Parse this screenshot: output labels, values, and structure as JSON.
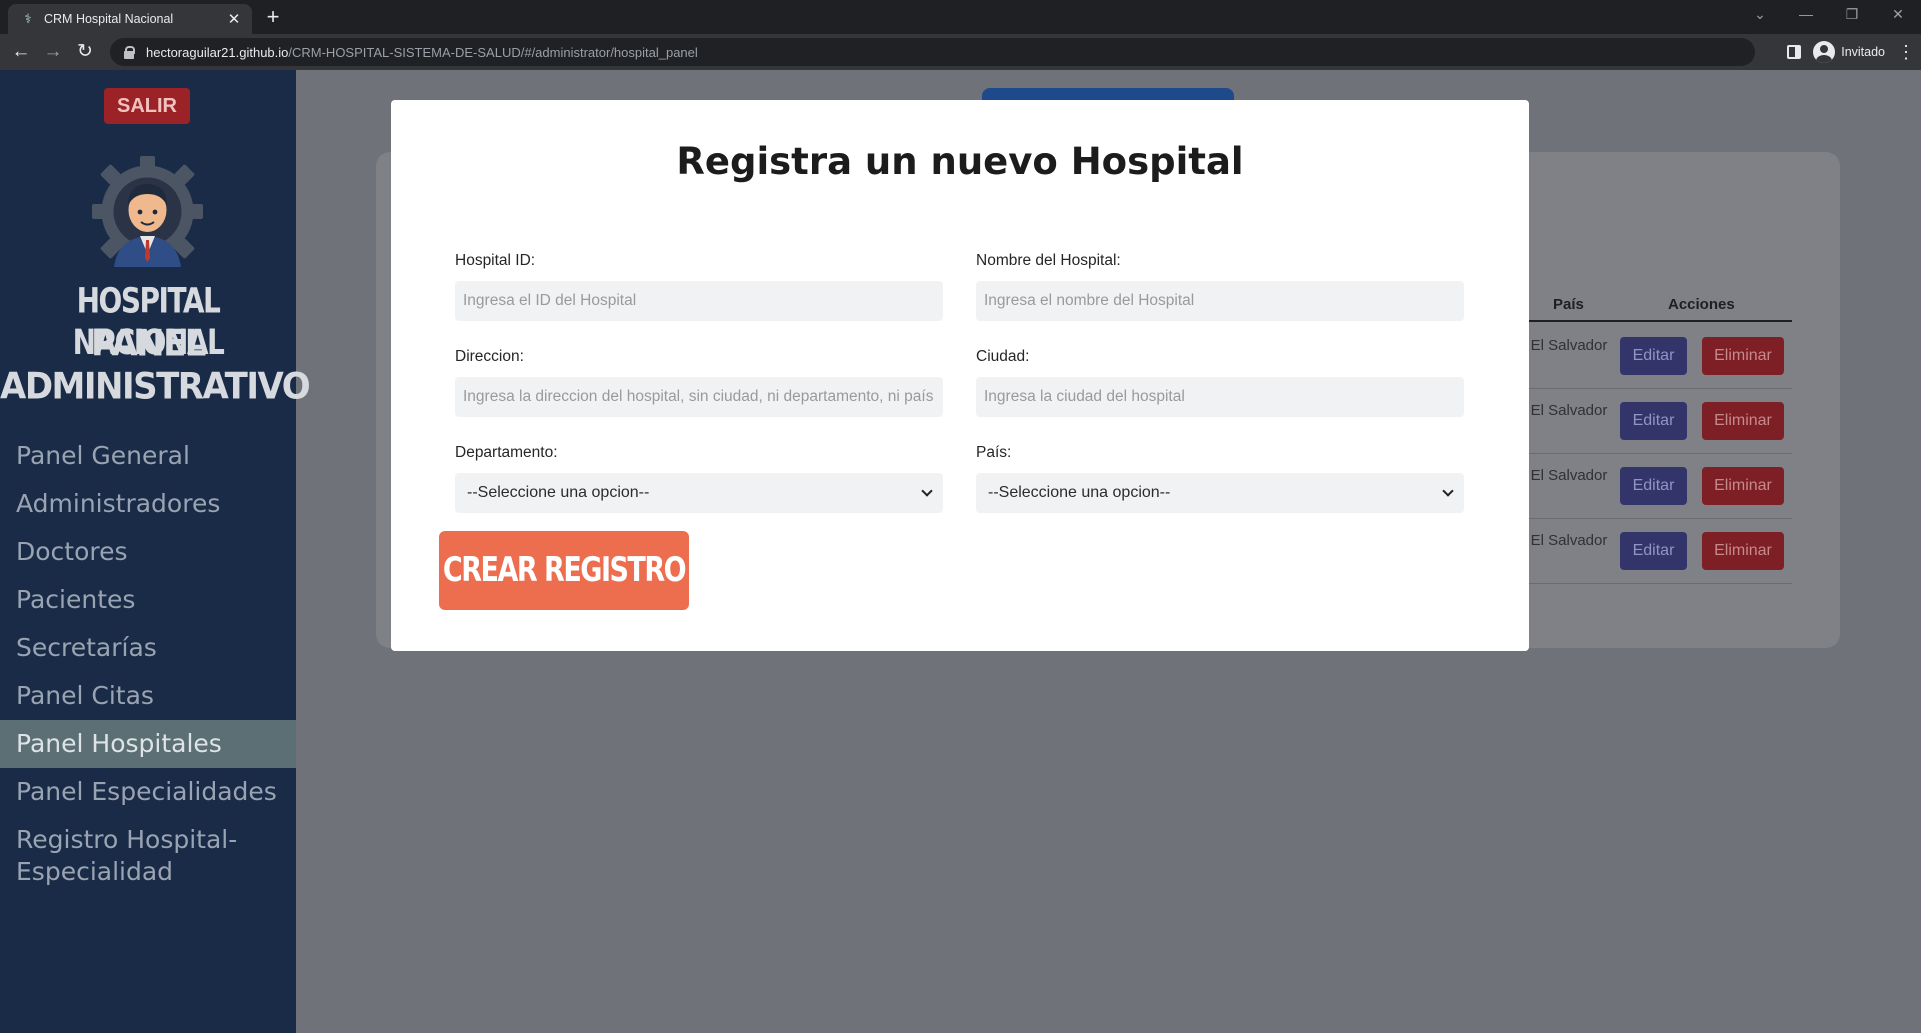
{
  "browser": {
    "tab_title": "CRM Hospital Nacional",
    "tab_close": "✕",
    "new_tab": "+",
    "url_host": "hectoraguilar21.github.io",
    "url_path": "/CRM-HOSPITAL-SISTEMA-DE-SALUD/#/administrator/hospital_panel",
    "profile_label": "Invitado",
    "back": "←",
    "forward": "→",
    "reload": "↻",
    "menu": "⋮",
    "win_dropdown": "⌄",
    "win_minimize": "—",
    "win_restore": "❐",
    "win_close": "✕"
  },
  "sidebar": {
    "logout_label": "SALIR",
    "brand_title": "HOSPITAL NACIONAL",
    "brand_subtitle_1": "PANEL",
    "brand_subtitle_2": "ADMINISTRATIVO",
    "logo_icon": "doctor-gear-icon",
    "items": [
      {
        "label": "Panel General",
        "active": false
      },
      {
        "label": "Administradores",
        "active": false
      },
      {
        "label": "Doctores",
        "active": false
      },
      {
        "label": "Pacientes",
        "active": false
      },
      {
        "label": "Secretarías",
        "active": false
      },
      {
        "label": "Panel Citas",
        "active": false
      },
      {
        "label": "Panel Hospitales",
        "active": true
      },
      {
        "label": "Panel Especialidades",
        "active": false
      },
      {
        "label": "Registro Hospital-Especialidad",
        "active": false
      }
    ]
  },
  "table": {
    "headers": {
      "country": "País",
      "actions": "Acciones"
    },
    "edit_label": "Editar",
    "delete_label": "Eliminar",
    "rows": [
      {
        "country": "El Salvador"
      },
      {
        "country": "El Salvador"
      },
      {
        "country": "El Salvador"
      },
      {
        "country": "El Salvador"
      }
    ]
  },
  "modal": {
    "title": "Registra un nuevo Hospital",
    "fields": {
      "hospital_id": {
        "label": "Hospital ID:",
        "placeholder": "Ingresa el ID del Hospital",
        "value": ""
      },
      "hospital_name": {
        "label": "Nombre del Hospital:",
        "placeholder": "Ingresa el nombre del Hospital",
        "value": ""
      },
      "address": {
        "label": "Direccion:",
        "placeholder": "Ingresa la direccion del hospital, sin ciudad, ni departamento, ni país",
        "value": ""
      },
      "city": {
        "label": "Ciudad:",
        "placeholder": "Ingresa la ciudad del hospital",
        "value": ""
      },
      "department": {
        "label": "Departamento:",
        "selected": "--Seleccione una opcion--"
      },
      "country": {
        "label": "País:",
        "selected": "--Seleccione una opcion--"
      }
    },
    "submit_label": "CREAR REGISTRO"
  },
  "colors": {
    "sidebar_bg": "#1a2b47",
    "sidebar_active": "#5b6f74",
    "logout_bg": "#9b2226",
    "submit_bg": "#ed6d4f",
    "edit_bg": "#33346a",
    "delete_bg": "#7d1f24",
    "overlay_bg": "#6f7278"
  }
}
